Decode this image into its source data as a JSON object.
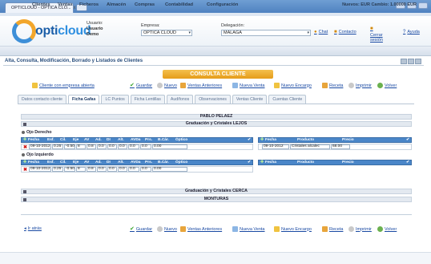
{
  "browser": {
    "tab_title": "OPTICLOUD - OPTICA CLO...",
    "tab_close": "x"
  },
  "header": {
    "logo_prefix": "opti",
    "logo_suffix": "cloud",
    "user_label": "Usuario:",
    "user_value1": "Usuario",
    "user_value2": "Demo",
    "empresa_label": "Empresa:",
    "empresa_value": "OPTICA CLOUD",
    "delegacion_label": "Delegación:",
    "delegacion_value": "MALAGA",
    "link_chat": "Chat",
    "link_contacto": "Contacto",
    "link_cerrar": "Cerrar sesión",
    "link_ayuda": "Ayuda"
  },
  "menu": {
    "items": [
      "Clientes",
      "Ventas",
      "Ficheros",
      "Almacén",
      "Compras",
      "Contabilidad",
      "Configuración"
    ],
    "right_text": "Nuevos: EUR Cambio: 1.00000 EUR"
  },
  "page": {
    "title": "Alta, Consulta, Modificación, Borrado y Listados de Clientes",
    "banner": "CONSULTA CLIENTE"
  },
  "toolbar": {
    "cliente_link": "Cliente con empresa abierta",
    "actions": [
      "Guardar",
      "Nuevo",
      "Ventas Anteriores",
      "Nueva Venta",
      "Nuevo Encargo",
      "Receta",
      "Imprimir",
      "Volver"
    ]
  },
  "tabs": [
    "Datos contacto cliente",
    "Ficha Gafas",
    "LC Puntos",
    "Ficha Lentillas",
    "Audífonos",
    "Observaciones",
    "Ventas Cliente",
    "Cuentas Cliente"
  ],
  "content": {
    "patient_name": "PABLO PELAEZ",
    "section_far": "Graduación y Cristales LEJOS",
    "eye_right": "Ojo Derecho",
    "eye_left": "Ojo Izquierdo",
    "section_near": "Graduación y Cristales CERCA",
    "section_frames": "MONTURAS"
  },
  "grad_columns": [
    "Fecha",
    "Esf.",
    "Cil.",
    "Eje",
    "AV",
    "Ad.",
    "DI",
    "Alt.",
    "AVDa",
    "Prs.",
    "B.Cár.",
    "Óptico"
  ],
  "prod_columns": [
    "Fecha",
    "Producto",
    "Precio"
  ],
  "right_eye_row": {
    "fecha": "09-10-2012",
    "v1": "0.25",
    "v2": "-0.50",
    "v3": "8",
    "v4": "0.8",
    "v5": "0.0",
    "v6": "0.0",
    "v7": "0.0",
    "v8": "0.0",
    "v9": "0.0",
    "optico": "0.00"
  },
  "right_eye_product": {
    "fecha": "09-10-2012",
    "producto": "Cristales alcalec",
    "precio": "68.00"
  },
  "left_eye_row": {
    "fecha": "09-10-2012",
    "v1": "0.25",
    "v2": "-0.50",
    "v3": "8",
    "v4": "0.8",
    "v5": "0.0",
    "v6": "0.0",
    "v7": "0.0",
    "v8": "0.0",
    "v9": "0.0",
    "optico": "0.00"
  },
  "bottom": {
    "back_link": "Ir atrás"
  }
}
